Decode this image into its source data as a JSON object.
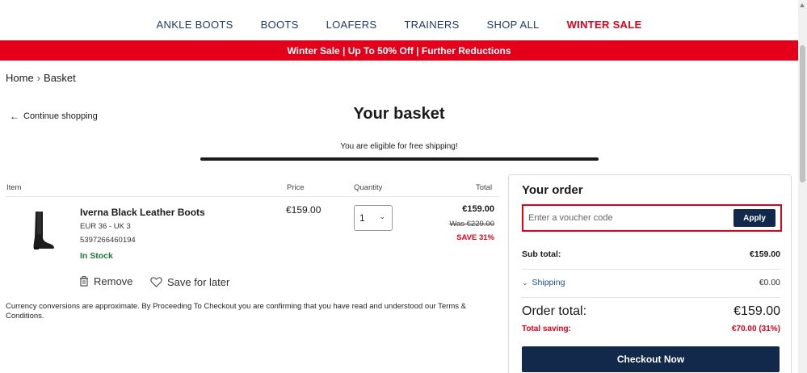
{
  "nav": {
    "items": [
      {
        "label": "ANKLE BOOTS"
      },
      {
        "label": "BOOTS"
      },
      {
        "label": "LOAFERS"
      },
      {
        "label": "TRAINERS"
      },
      {
        "label": "SHOP ALL"
      },
      {
        "label": "WINTER SALE"
      }
    ]
  },
  "banner": {
    "text": "Winter Sale | Up To 50% Off | Further Reductions"
  },
  "breadcrumb": {
    "home": "Home",
    "separator": "›",
    "current": "Basket"
  },
  "continue_label": "Continue shopping",
  "page_title": "Your basket",
  "shipping_message": "You are eligible for free shipping!",
  "table": {
    "headers": {
      "item": "Item",
      "price": "Price",
      "quantity": "Quantity",
      "total": "Total"
    }
  },
  "product": {
    "name": "Iverna Black Leather Boots",
    "size": "EUR 36 - UK 3",
    "sku": "5397266460194",
    "stock": "In Stock",
    "price": "€159.00",
    "quantity": "1",
    "total": "€159.00",
    "was": "Was €229.00",
    "save": "SAVE 31%",
    "remove_label": "Remove",
    "save_later_label": "Save for later"
  },
  "note": "Currency conversions are approximate. By Proceeding To Checkout you are confirming that you have read and understood our Terms & Conditions.",
  "order": {
    "title": "Your order",
    "voucher_placeholder": "Enter a voucher code",
    "apply_label": "Apply",
    "subtotal_label": "Sub total:",
    "subtotal_value": "€159.00",
    "shipping_label": "Shipping",
    "shipping_value": "€0.00",
    "total_label": "Order total:",
    "total_value": "€159.00",
    "saving_label": "Total saving:",
    "saving_value": "€70.00 (31%)",
    "checkout_label": "Checkout Now"
  },
  "colors": {
    "brand_navy": "#13294b",
    "sale_red": "#e4001b",
    "stock_green": "#1a7a32",
    "nav_blue": "#1e3a6d"
  }
}
